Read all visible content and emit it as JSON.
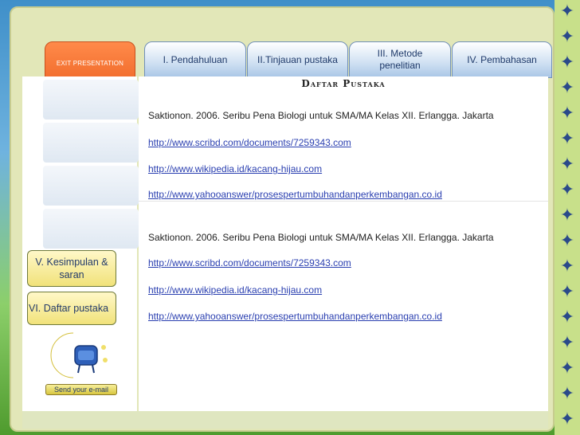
{
  "tabs": {
    "exit_label": "EXIT PRESENTATION",
    "items": [
      {
        "label": "I. Pendahuluan"
      },
      {
        "label": "II.Tinjauan pustaka"
      },
      {
        "label": "III. Metode penelitian"
      },
      {
        "label": "IV. Pembahasan"
      }
    ]
  },
  "sidebar": {
    "items": [
      {
        "label": "V. Kesimpulan & saran"
      },
      {
        "label": "VI. Daftar pustaka"
      }
    ],
    "send_email_label": "Send your e-mail"
  },
  "main": {
    "title": "Daftar Pustaka",
    "references": [
      {
        "text": "Saktionon. 2006. Seribu Pena Biologi untuk SMA/MA Kelas XII. Erlangga. Jakarta"
      },
      {
        "text": "http://www.scribd.com/documents/7259343.com"
      },
      {
        "text": "http://www.wikipedia.id/kacang-hijau.com"
      },
      {
        "text": "http://www.yahooanswer/prosespertumbuhandanperkembangan.co.id"
      },
      {
        "text": "Saktionon. 2006. Seribu Pena Biologi untuk SMA/MA Kelas XII. Erlangga. Jakarta"
      },
      {
        "text": "http://www.scribd.com/documents/7259343.com"
      },
      {
        "text": "http://www.wikipedia.id/kacang-hijau.com"
      },
      {
        "text": "http://www.yahooanswer/prosespertumbuhandanperkembangan.co.id"
      }
    ]
  },
  "colors": {
    "exit_tab": "#f06a2a",
    "link": "#2a3fb0",
    "frame": "#e2e7b8",
    "star": "#2a4a8a"
  }
}
